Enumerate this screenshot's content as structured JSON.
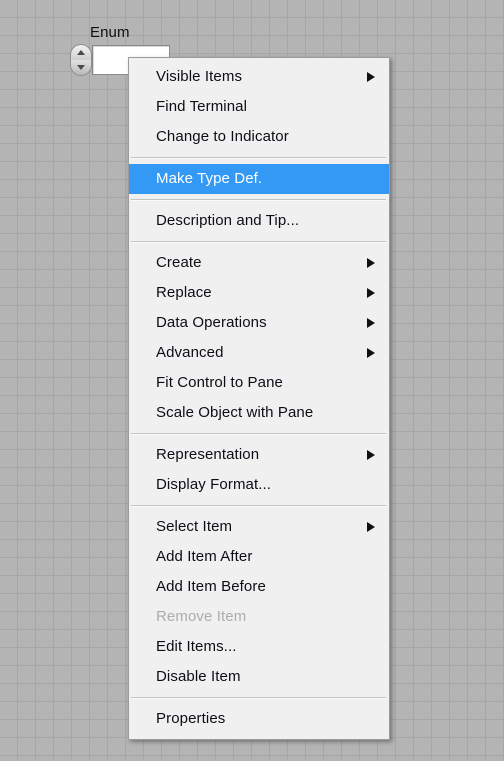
{
  "panel": {
    "background_color": "#b4b4b4",
    "grid_line_color": "#a6a6a6"
  },
  "control": {
    "label": "Enum",
    "value": "",
    "increment_icon": "up-arrow-icon",
    "decrement_icon": "down-arrow-icon"
  },
  "context_menu": {
    "background_color": "#f0f0f0",
    "highlight_color": "#3399f5",
    "text_color": "#0d0d16",
    "disabled_text_color": "#adadad",
    "groups": [
      {
        "items": [
          {
            "label": "Visible Items",
            "submenu": true,
            "disabled": false,
            "highlighted": false
          },
          {
            "label": "Find Terminal",
            "submenu": false,
            "disabled": false,
            "highlighted": false
          },
          {
            "label": "Change to Indicator",
            "submenu": false,
            "disabled": false,
            "highlighted": false
          }
        ]
      },
      {
        "items": [
          {
            "label": "Make Type Def.",
            "submenu": false,
            "disabled": false,
            "highlighted": true
          }
        ]
      },
      {
        "items": [
          {
            "label": "Description and Tip...",
            "submenu": false,
            "disabled": false,
            "highlighted": false
          }
        ]
      },
      {
        "items": [
          {
            "label": "Create",
            "submenu": true,
            "disabled": false,
            "highlighted": false
          },
          {
            "label": "Replace",
            "submenu": true,
            "disabled": false,
            "highlighted": false
          },
          {
            "label": "Data Operations",
            "submenu": true,
            "disabled": false,
            "highlighted": false
          },
          {
            "label": "Advanced",
            "submenu": true,
            "disabled": false,
            "highlighted": false
          },
          {
            "label": "Fit Control to Pane",
            "submenu": false,
            "disabled": false,
            "highlighted": false
          },
          {
            "label": "Scale Object with Pane",
            "submenu": false,
            "disabled": false,
            "highlighted": false
          }
        ]
      },
      {
        "items": [
          {
            "label": "Representation",
            "submenu": true,
            "disabled": false,
            "highlighted": false
          },
          {
            "label": "Display Format...",
            "submenu": false,
            "disabled": false,
            "highlighted": false
          }
        ]
      },
      {
        "items": [
          {
            "label": "Select Item",
            "submenu": true,
            "disabled": false,
            "highlighted": false
          },
          {
            "label": "Add Item After",
            "submenu": false,
            "disabled": false,
            "highlighted": false
          },
          {
            "label": "Add Item Before",
            "submenu": false,
            "disabled": false,
            "highlighted": false
          },
          {
            "label": "Remove Item",
            "submenu": false,
            "disabled": true,
            "highlighted": false
          },
          {
            "label": "Edit Items...",
            "submenu": false,
            "disabled": false,
            "highlighted": false
          },
          {
            "label": "Disable Item",
            "submenu": false,
            "disabled": false,
            "highlighted": false
          }
        ]
      },
      {
        "items": [
          {
            "label": "Properties",
            "submenu": false,
            "disabled": false,
            "highlighted": false
          }
        ]
      }
    ]
  }
}
